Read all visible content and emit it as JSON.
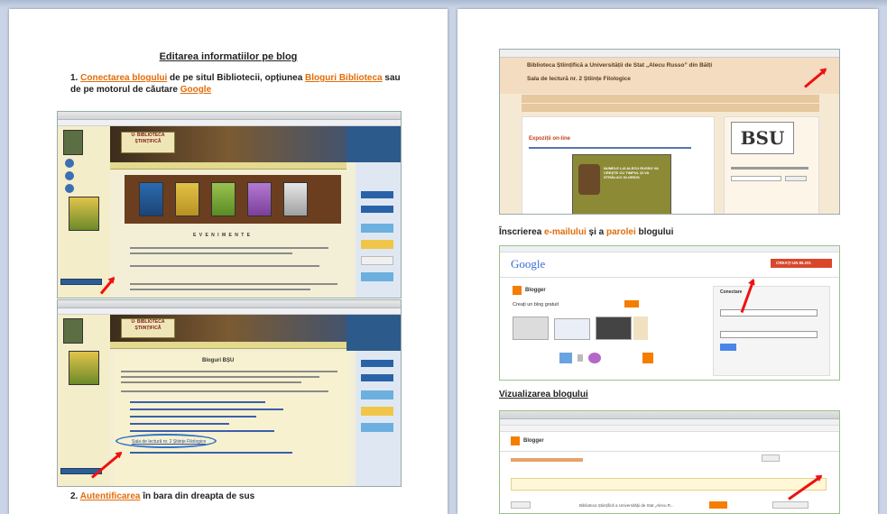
{
  "left_page": {
    "title": "Editarea informatiilor   pe blog",
    "step1": {
      "number": "1.",
      "link1": "Conectarea blogului",
      "text1": " de pe situl Bibliotecii, opțiunea ",
      "link2": "Bloguri Biblioteca",
      "text2": " sau de pe motorul de căutare ",
      "link3": "Google"
    },
    "step2": {
      "number": "2.",
      "link": "Autentificarea",
      "text": " în bara din dreapta de sus"
    },
    "shot1": {
      "site_logo": "U∙ BIBLIOTECA ȘTIINȚIFICĂ",
      "section": "E V E N I M E N T E"
    },
    "shot2": {
      "site_logo": "U∙ BIBLIOTECA ȘTIINȚIFICĂ",
      "heading": "Bloguri BȘU",
      "highlighted_link": "Sala de lectură nr. 2 Științe Filologice"
    }
  },
  "right_page": {
    "shot1": {
      "blog_title": "Biblioteca Științifică a Universității de Stat „Alecu Russo” din Bălți",
      "blog_subtitle": "Sala de lectură nr. 2 Științe Filologice",
      "post_title": "Expoziții on-line",
      "poster_text": "NUMELE LUI ALECU RUSSO VA CREȘTE CU TIMPUL ȘI VA STRĂLUCI GLORIOS",
      "logo": "BSU"
    },
    "label_email": {
      "prefix": "Înscrierea ",
      "link1": "e-mailului",
      "mid": " și a ",
      "link2": "parolei",
      "suffix": " blogului"
    },
    "shot2": {
      "brand": "Google",
      "service": "Blogger",
      "tagline": "Creați un blog gratuit",
      "signin_label": "Conectare",
      "create_button": "CREAȚI UN BLOG"
    },
    "label_view": "Vizualizarea blogului",
    "shot3": {
      "service": "Blogger",
      "blog_name": "Biblioteca Științifică a Universității de Stat „Alecu R..."
    }
  },
  "colors": {
    "accent": "#e36c09",
    "arrow": "#ee1111",
    "window_bg": "#c9d4e6"
  }
}
